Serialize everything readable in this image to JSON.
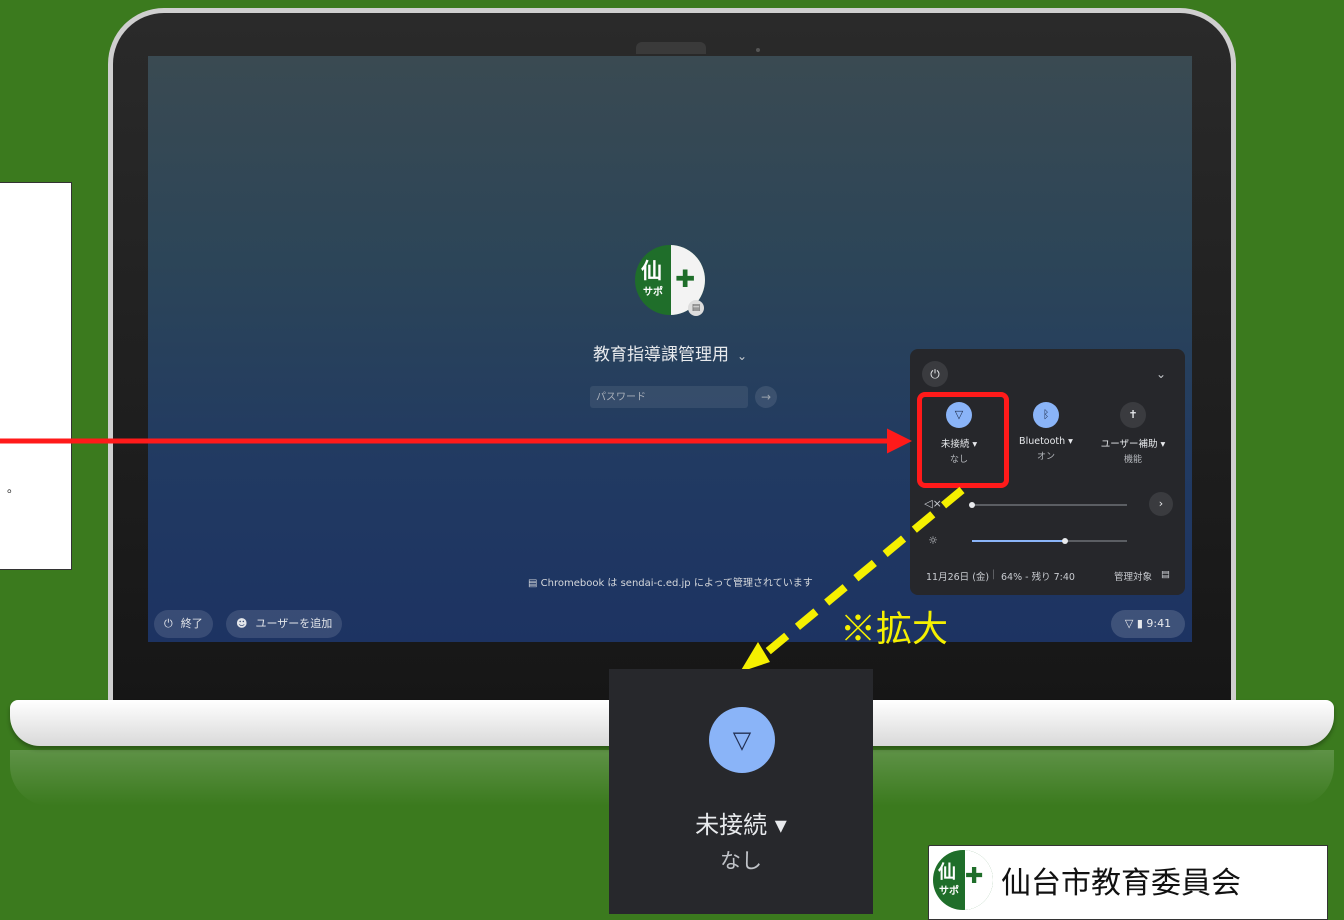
{
  "login": {
    "user_name": "教育指導課管理用",
    "user_chevron": "⌄",
    "password_placeholder": "パスワード",
    "submit_arrow": "→",
    "managed_notice": "Chromebook は sendai-c.ed.jp によって管理されています",
    "managed_icon": "▤",
    "avatar_kanji": "仙",
    "avatar_sub": "サポ"
  },
  "shelf": {
    "shutdown_label": "終了",
    "add_user_label": "ユーザーを追加",
    "time": "9:41",
    "wifi_icon": "▽",
    "battery_icon": "▮"
  },
  "quick_settings": {
    "power_icon": "⏻",
    "collapse_icon": "⌄",
    "network": {
      "label": "未接続 ▾",
      "sublabel": "なし",
      "icon": "wifi-off"
    },
    "bluetooth": {
      "label": "Bluetooth ▾",
      "sublabel": "オン",
      "icon": "bluetooth"
    },
    "accessibility": {
      "label": "ユーザー補助 ▾",
      "sublabel": "機能",
      "icon": "accessibility"
    },
    "volume_level": 0.0,
    "brightness_level": 0.6,
    "date": "11月26日 (金)",
    "battery": "64% - 残り 7:40",
    "managed": "管理対象",
    "more_arrow": "›"
  },
  "annotations": {
    "zoom_label": "※拡大",
    "zoom_network_label": "未接続 ▾",
    "zoom_network_sublabel": "なし",
    "callout_mark": "。",
    "board_name": "仙台市教育委員会",
    "board_logo_kanji": "仙",
    "board_logo_sub": "サポ"
  },
  "colors": {
    "background": "#3b7a1e",
    "accent_blue": "#8ab4f8",
    "highlight_red": "#ff1a1a",
    "arrow_yellow": "#f5f000"
  }
}
